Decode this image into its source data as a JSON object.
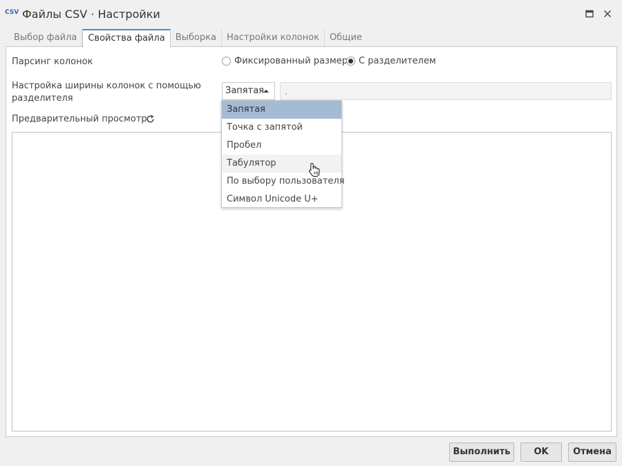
{
  "window": {
    "icon_text": "CSV",
    "title": "Файлы CSV · Настройки"
  },
  "tabs": [
    {
      "label": "Выбор файла",
      "active": false
    },
    {
      "label": "Свойства файла",
      "active": true
    },
    {
      "label": "Выборка",
      "active": false
    },
    {
      "label": "Настройки колонок",
      "active": false
    },
    {
      "label": "Общие",
      "active": false
    }
  ],
  "form": {
    "parsing_label": "Парсинг колонок",
    "radio_fixed_label": "Фиксированный размер",
    "radio_delim_label": "С разделителем",
    "radio_selected": "delimited",
    "width_label": "Настройка ширины колонок с помощью разделителя",
    "delimiter_select_value": "Запятая",
    "delimiter_input_value": ",",
    "preview_label": "Предварительный просмотр"
  },
  "dropdown": {
    "items": [
      "Запятая",
      "Точка с запятой",
      "Пробел",
      "Табулятор",
      "По выбору пользователя",
      "Символ Unicode U+"
    ],
    "selected_index": 0,
    "hover_index": 3
  },
  "footer": {
    "run_label": "Выполнить",
    "ok_label": "OK",
    "cancel_label": "Отмена"
  },
  "icons": {
    "maximize": "maximize-icon",
    "close": "close-icon",
    "refresh": "refresh-icon",
    "cursor": "hand-pointer-cursor-icon"
  },
  "colors": {
    "active_tab_accent": "#4a8ec6",
    "dropdown_selected_bg": "#a4bbd6",
    "app_icon_color": "#2f6aa8"
  }
}
